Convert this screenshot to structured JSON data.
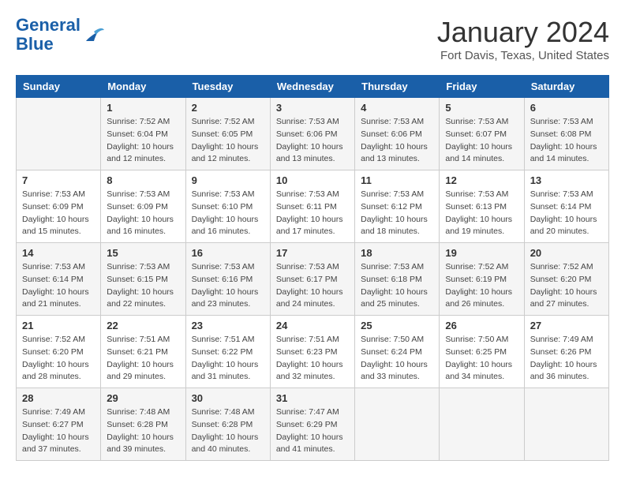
{
  "logo": {
    "line1": "General",
    "line2": "Blue"
  },
  "title": "January 2024",
  "subtitle": "Fort Davis, Texas, United States",
  "headers": [
    "Sunday",
    "Monday",
    "Tuesday",
    "Wednesday",
    "Thursday",
    "Friday",
    "Saturday"
  ],
  "weeks": [
    [
      {
        "day": "",
        "info": ""
      },
      {
        "day": "1",
        "info": "Sunrise: 7:52 AM\nSunset: 6:04 PM\nDaylight: 10 hours\nand 12 minutes."
      },
      {
        "day": "2",
        "info": "Sunrise: 7:52 AM\nSunset: 6:05 PM\nDaylight: 10 hours\nand 12 minutes."
      },
      {
        "day": "3",
        "info": "Sunrise: 7:53 AM\nSunset: 6:06 PM\nDaylight: 10 hours\nand 13 minutes."
      },
      {
        "day": "4",
        "info": "Sunrise: 7:53 AM\nSunset: 6:06 PM\nDaylight: 10 hours\nand 13 minutes."
      },
      {
        "day": "5",
        "info": "Sunrise: 7:53 AM\nSunset: 6:07 PM\nDaylight: 10 hours\nand 14 minutes."
      },
      {
        "day": "6",
        "info": "Sunrise: 7:53 AM\nSunset: 6:08 PM\nDaylight: 10 hours\nand 14 minutes."
      }
    ],
    [
      {
        "day": "7",
        "info": "Sunrise: 7:53 AM\nSunset: 6:09 PM\nDaylight: 10 hours\nand 15 minutes."
      },
      {
        "day": "8",
        "info": "Sunrise: 7:53 AM\nSunset: 6:09 PM\nDaylight: 10 hours\nand 16 minutes."
      },
      {
        "day": "9",
        "info": "Sunrise: 7:53 AM\nSunset: 6:10 PM\nDaylight: 10 hours\nand 16 minutes."
      },
      {
        "day": "10",
        "info": "Sunrise: 7:53 AM\nSunset: 6:11 PM\nDaylight: 10 hours\nand 17 minutes."
      },
      {
        "day": "11",
        "info": "Sunrise: 7:53 AM\nSunset: 6:12 PM\nDaylight: 10 hours\nand 18 minutes."
      },
      {
        "day": "12",
        "info": "Sunrise: 7:53 AM\nSunset: 6:13 PM\nDaylight: 10 hours\nand 19 minutes."
      },
      {
        "day": "13",
        "info": "Sunrise: 7:53 AM\nSunset: 6:14 PM\nDaylight: 10 hours\nand 20 minutes."
      }
    ],
    [
      {
        "day": "14",
        "info": "Sunrise: 7:53 AM\nSunset: 6:14 PM\nDaylight: 10 hours\nand 21 minutes."
      },
      {
        "day": "15",
        "info": "Sunrise: 7:53 AM\nSunset: 6:15 PM\nDaylight: 10 hours\nand 22 minutes."
      },
      {
        "day": "16",
        "info": "Sunrise: 7:53 AM\nSunset: 6:16 PM\nDaylight: 10 hours\nand 23 minutes."
      },
      {
        "day": "17",
        "info": "Sunrise: 7:53 AM\nSunset: 6:17 PM\nDaylight: 10 hours\nand 24 minutes."
      },
      {
        "day": "18",
        "info": "Sunrise: 7:53 AM\nSunset: 6:18 PM\nDaylight: 10 hours\nand 25 minutes."
      },
      {
        "day": "19",
        "info": "Sunrise: 7:52 AM\nSunset: 6:19 PM\nDaylight: 10 hours\nand 26 minutes."
      },
      {
        "day": "20",
        "info": "Sunrise: 7:52 AM\nSunset: 6:20 PM\nDaylight: 10 hours\nand 27 minutes."
      }
    ],
    [
      {
        "day": "21",
        "info": "Sunrise: 7:52 AM\nSunset: 6:20 PM\nDaylight: 10 hours\nand 28 minutes."
      },
      {
        "day": "22",
        "info": "Sunrise: 7:51 AM\nSunset: 6:21 PM\nDaylight: 10 hours\nand 29 minutes."
      },
      {
        "day": "23",
        "info": "Sunrise: 7:51 AM\nSunset: 6:22 PM\nDaylight: 10 hours\nand 31 minutes."
      },
      {
        "day": "24",
        "info": "Sunrise: 7:51 AM\nSunset: 6:23 PM\nDaylight: 10 hours\nand 32 minutes."
      },
      {
        "day": "25",
        "info": "Sunrise: 7:50 AM\nSunset: 6:24 PM\nDaylight: 10 hours\nand 33 minutes."
      },
      {
        "day": "26",
        "info": "Sunrise: 7:50 AM\nSunset: 6:25 PM\nDaylight: 10 hours\nand 34 minutes."
      },
      {
        "day": "27",
        "info": "Sunrise: 7:49 AM\nSunset: 6:26 PM\nDaylight: 10 hours\nand 36 minutes."
      }
    ],
    [
      {
        "day": "28",
        "info": "Sunrise: 7:49 AM\nSunset: 6:27 PM\nDaylight: 10 hours\nand 37 minutes."
      },
      {
        "day": "29",
        "info": "Sunrise: 7:48 AM\nSunset: 6:28 PM\nDaylight: 10 hours\nand 39 minutes."
      },
      {
        "day": "30",
        "info": "Sunrise: 7:48 AM\nSunset: 6:28 PM\nDaylight: 10 hours\nand 40 minutes."
      },
      {
        "day": "31",
        "info": "Sunrise: 7:47 AM\nSunset: 6:29 PM\nDaylight: 10 hours\nand 41 minutes."
      },
      {
        "day": "",
        "info": ""
      },
      {
        "day": "",
        "info": ""
      },
      {
        "day": "",
        "info": ""
      }
    ]
  ]
}
